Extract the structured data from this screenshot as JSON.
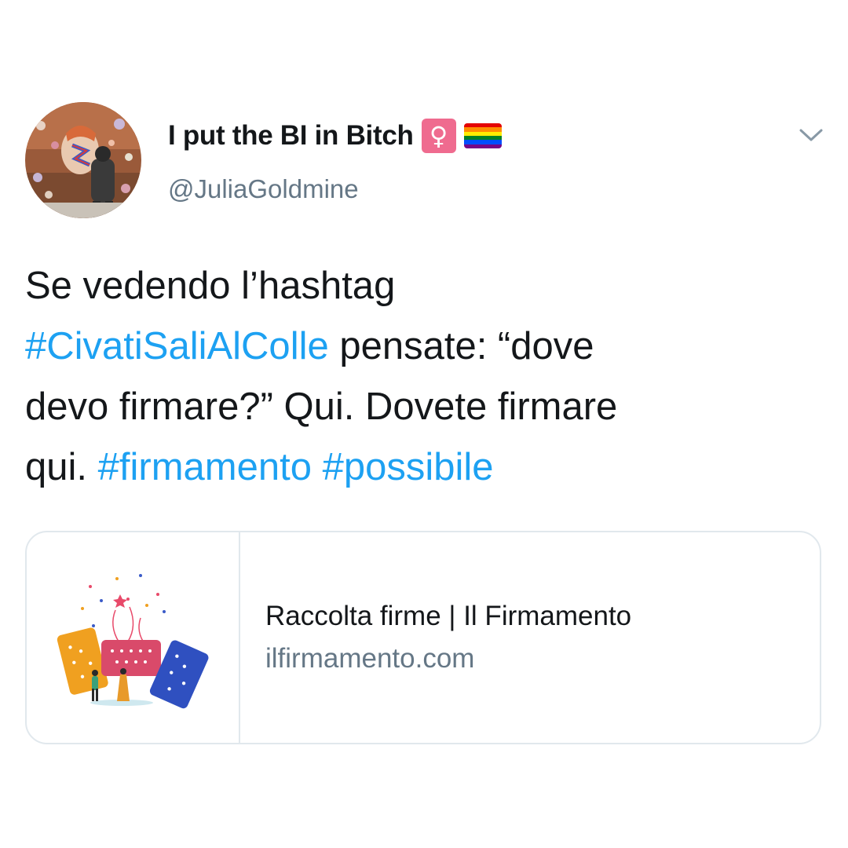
{
  "tweet": {
    "display_name": "I put the BI in Bitch",
    "badges": {
      "venus_icon": "venus-symbol-icon",
      "flag_icon": "rainbow-pride-flag-icon"
    },
    "venus_glyph": "♀",
    "handle": "@JuliaGoldmine",
    "menu_icon": "chevron-down-icon",
    "text_lines": [
      [
        {
          "text": "Se vedendo l’hashtag",
          "type": "text"
        }
      ],
      [
        {
          "text": "#CivatiSaliAlColle",
          "type": "hashtag"
        },
        {
          "text": " pensate: “dove",
          "type": "text"
        }
      ],
      [
        {
          "text": "devo firmare?” Qui. Dovete firmare",
          "type": "text"
        }
      ],
      [
        {
          "text": "qui. ",
          "type": "text"
        },
        {
          "text": "#firmamento",
          "type": "hashtag"
        },
        {
          "text": " ",
          "type": "text"
        },
        {
          "text": "#possibile",
          "type": "hashtag"
        }
      ]
    ]
  },
  "card": {
    "title": "Raccolta firme | Il Firmamento",
    "domain": "ilfirmamento.com",
    "thumbnail_icon": "signature-collection-illustration"
  },
  "colors": {
    "text": "#14171a",
    "secondary": "#657786",
    "hashtag": "#1da1f2",
    "border": "#e1e8ed",
    "venus_badge": "#ef6b8f",
    "rainbow": [
      "#e40303",
      "#ff8c00",
      "#ffed00",
      "#008026",
      "#004dff",
      "#750787"
    ]
  }
}
